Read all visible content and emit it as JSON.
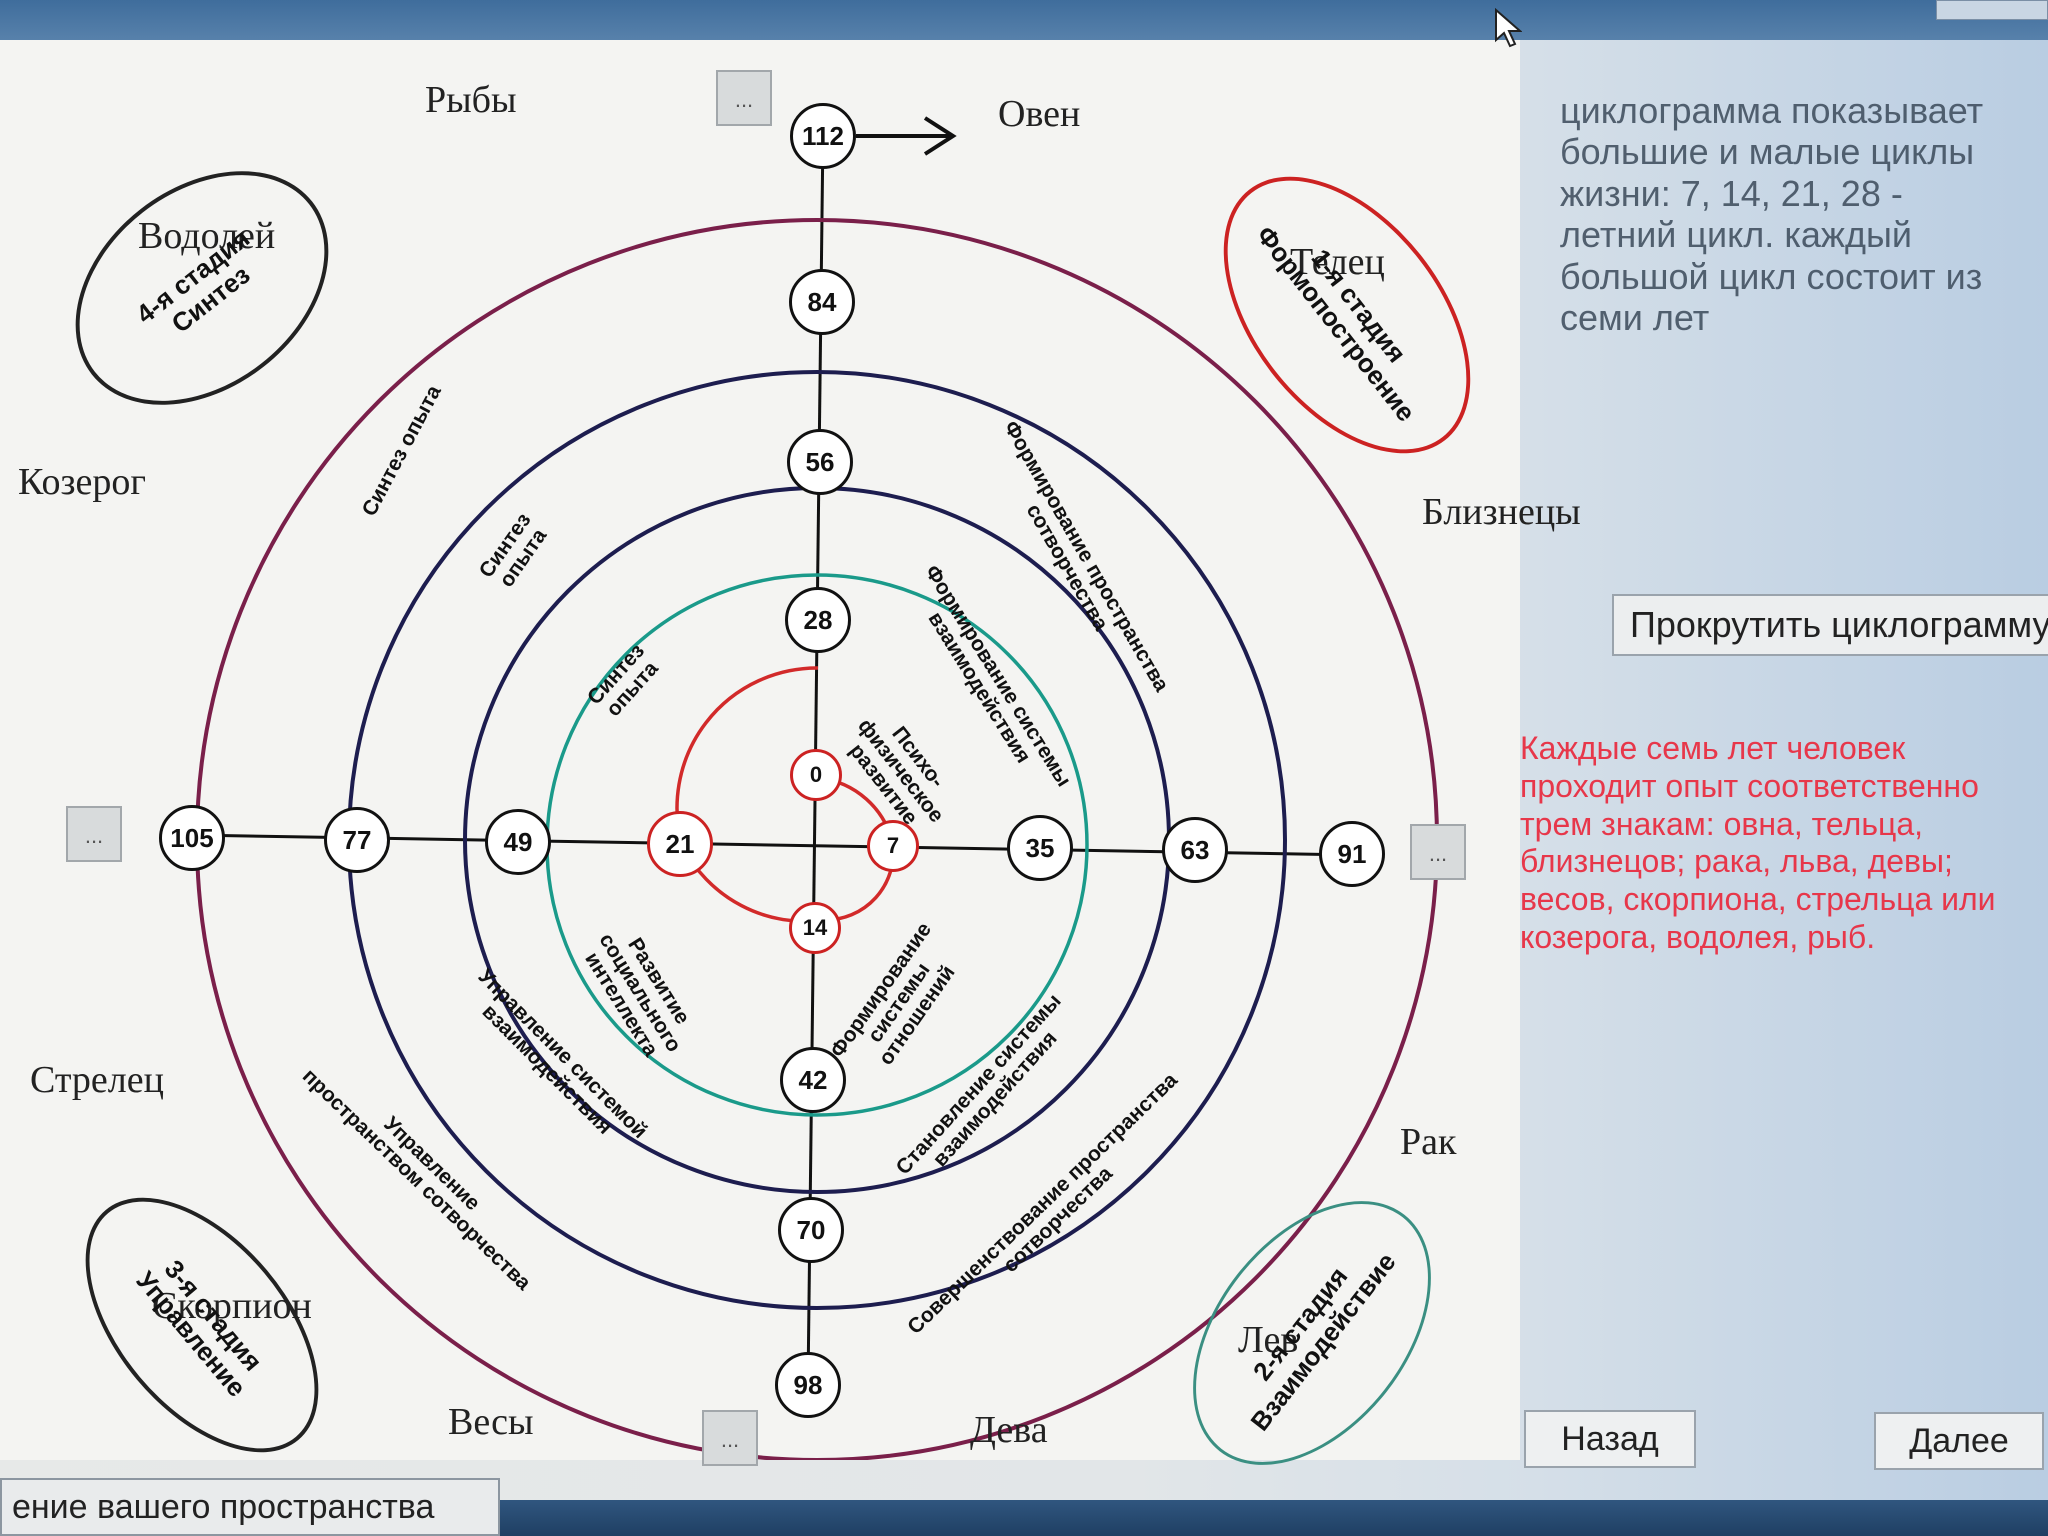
{
  "zodiac": {
    "ryby": "Рыбы",
    "oven": "Овен",
    "vodoley": "Водолей",
    "telets": "Телец",
    "kozerog": "Козерог",
    "bliznetsy": "Близнецы",
    "strelets": "Стрелец",
    "rak": "Рак",
    "skorpion": "Скорпион",
    "lev": "Лев",
    "vesy": "Весы",
    "deva": "Дева"
  },
  "stages": {
    "s1": "1-я стадия\nФормопостроение",
    "s2": "2-я стадия\nВзаимодействие",
    "s3": "3-я стадия\nУправление",
    "s4": "4-я стадия\nСинтез"
  },
  "nodes": {
    "n0": "0",
    "n7": "7",
    "n14": "14",
    "n21": "21",
    "n28": "28",
    "n35": "35",
    "n42": "42",
    "n49": "49",
    "n56": "56",
    "n63": "63",
    "n70": "70",
    "n77": "77",
    "n84": "84",
    "n91": "91",
    "n98": "98",
    "n105": "105",
    "n112": "112"
  },
  "ring_texts": {
    "t1": "Синтез опыта",
    "t2": "Синтез\nопыта",
    "t3": "Синтез\nопыта",
    "t4": "Психо-\nфизическое\nразвитие",
    "t5": "Формирование пространства\nсотворчества",
    "t6": "Формирование системы\nвзаимодействия",
    "t7": "Развитие\nсоциального\nинтеллекта",
    "t8": "Управление системой\nвзаимодействия",
    "t9": "Управление\nпространством сотворчества",
    "t10": "Формирование\nсистемы\nотношений",
    "t11": "Становление системы\nвзаимодействия",
    "t12": "Совершенствование пространства\nсотворчества"
  },
  "dots_label": "...",
  "info_text": "циклограмма показывает большие и малые циклы жизни: 7, 14, 21, 28 - летний цикл. каждый большой цикл состоит из семи лет",
  "scroll_button": "Прокрутить циклограмму",
  "red_text": "Каждые семь лет человек проходит опыт соответственно трем знакам: овна, тельца, близнецов; рака, льва, девы; весов, скорпиона, стрельца или козерога, водолея, рыб.",
  "buttons": {
    "back": "Назад",
    "next": "Далее"
  },
  "status_field": "ение вашего пространства",
  "colors": {
    "outer_ring": "#7a1f4a",
    "mid_ring": "#1d1d4f",
    "teal_ring": "#1a9a8a",
    "red_spiral": "#d22a2a",
    "red_text": "#e7374a"
  }
}
